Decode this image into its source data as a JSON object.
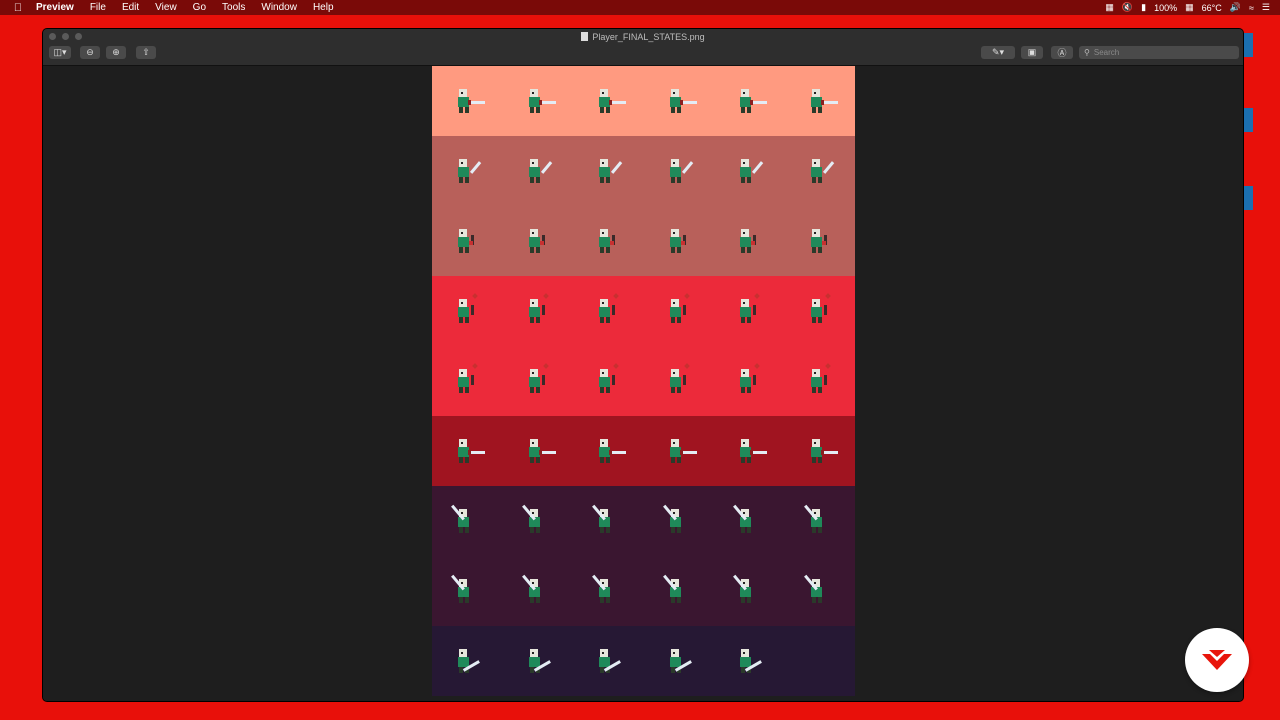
{
  "menubar": {
    "app_name": "Preview",
    "menus": [
      "File",
      "Edit",
      "View",
      "Go",
      "Tools",
      "Window",
      "Help"
    ],
    "battery": "100%",
    "temperature": "66°C"
  },
  "window": {
    "title": "Player_FINAL_STATES.png",
    "search_placeholder": "Search"
  },
  "sheet": {
    "bands": [
      {
        "color": "#ff9a80",
        "rows": 1
      },
      {
        "color": "#b8605a",
        "rows": 2
      },
      {
        "color": "#ec2a3a",
        "rows": 2
      },
      {
        "color": "#a01420",
        "rows": 1
      },
      {
        "color": "#3a1630",
        "rows": 2
      },
      {
        "color": "#261834",
        "rows": 1
      }
    ],
    "rows": [
      {
        "count": 6,
        "pose": "idle-sword"
      },
      {
        "count": 6,
        "pose": "swing"
      },
      {
        "count": 6,
        "pose": "hold"
      },
      {
        "count": 6,
        "pose": "hold-gem"
      },
      {
        "count": 6,
        "pose": "hold-gem"
      },
      {
        "count": 6,
        "pose": "dash"
      },
      {
        "count": 6,
        "pose": "attack"
      },
      {
        "count": 6,
        "pose": "raise"
      },
      {
        "count": 5,
        "pose": "spin"
      }
    ]
  },
  "colors": {
    "character_green": "#1f8a5a",
    "sword_blade": "#e4ecf4",
    "logo_red": "#e8150b"
  }
}
